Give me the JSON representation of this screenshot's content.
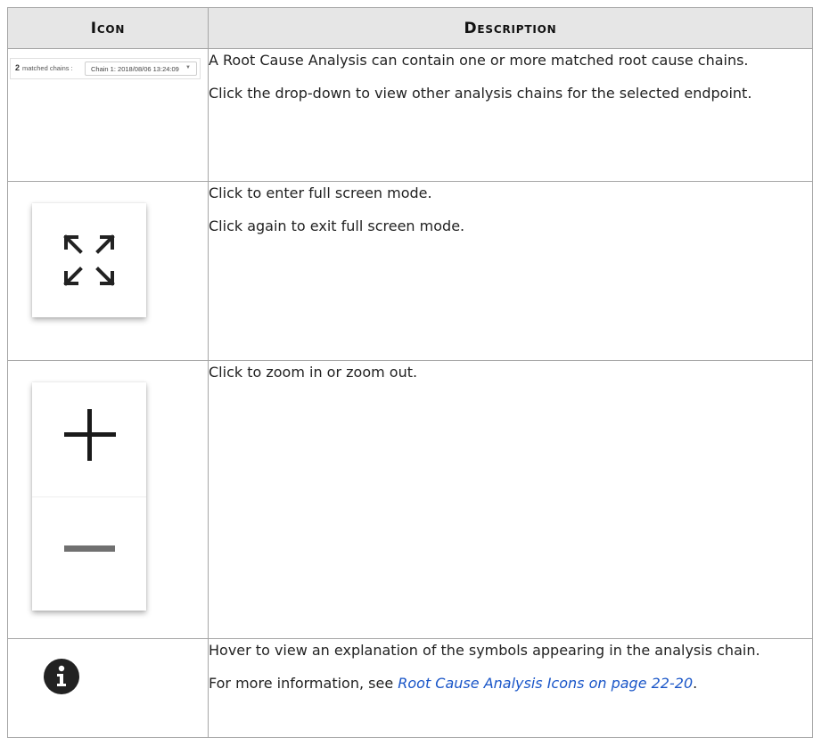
{
  "header": {
    "icon": "Icon",
    "description": "Description"
  },
  "rows": [
    {
      "icon": {
        "count": "2",
        "label": "matched chains :",
        "selected": "Chain 1: 2018/08/06 13:24:09"
      },
      "description": [
        "A Root Cause Analysis can contain one or more matched root cause chains.",
        "Click the drop-down to view other analysis chains for the selected endpoint."
      ]
    },
    {
      "icon": {
        "name": "fullscreen-icon"
      },
      "description": [
        "Click to enter full screen mode.",
        "Click again to exit full screen mode."
      ]
    },
    {
      "icon": {
        "name": "zoom-controls"
      },
      "description": [
        "Click to zoom in or zoom out."
      ]
    },
    {
      "icon": {
        "name": "info-icon"
      },
      "description": [
        "Hover to view an explanation of the symbols appearing in the analysis chain."
      ],
      "more": {
        "prefix": "For more information, see ",
        "link": "Root Cause Analysis Icons on page 22-20",
        "suffix": "."
      }
    }
  ]
}
